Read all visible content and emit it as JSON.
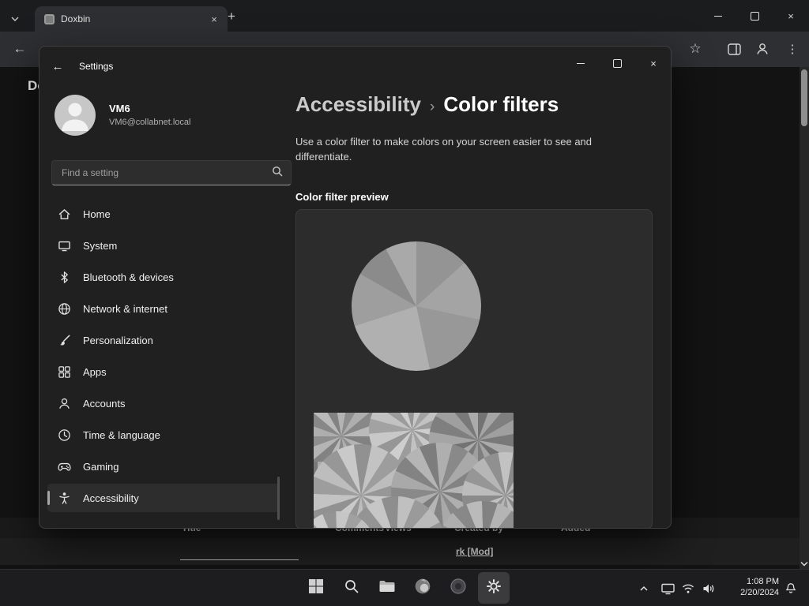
{
  "browser": {
    "tab_title": "Doxbin",
    "page": {
      "heading_fragment": "Do",
      "table": {
        "col_title": "Title",
        "col_comments": "Comments",
        "col_views": "Views",
        "col_created_by": "Created by",
        "col_added": "Added",
        "row_created_by": "rk [Mod]"
      }
    }
  },
  "settings": {
    "window_title": "Settings",
    "user": {
      "name": "VM6",
      "account": "VM6@collabnet.local"
    },
    "search_placeholder": "Find a setting",
    "nav": [
      {
        "label": "Home",
        "icon": "home-icon",
        "selected": false
      },
      {
        "label": "System",
        "icon": "system-icon",
        "selected": false
      },
      {
        "label": "Bluetooth & devices",
        "icon": "bluetooth-icon",
        "selected": false
      },
      {
        "label": "Network & internet",
        "icon": "network-icon",
        "selected": false
      },
      {
        "label": "Personalization",
        "icon": "personalization-icon",
        "selected": false
      },
      {
        "label": "Apps",
        "icon": "apps-icon",
        "selected": false
      },
      {
        "label": "Accounts",
        "icon": "accounts-icon",
        "selected": false
      },
      {
        "label": "Time & language",
        "icon": "time-language-icon",
        "selected": false
      },
      {
        "label": "Gaming",
        "icon": "gaming-icon",
        "selected": false
      },
      {
        "label": "Accessibility",
        "icon": "accessibility-icon",
        "selected": true
      }
    ],
    "breadcrumb": {
      "parent": "Accessibility",
      "separator": "›",
      "current": "Color filters"
    },
    "description": "Use a color filter to make colors on your screen easier to see and differentiate.",
    "preview_label": "Color filter preview",
    "pie_slices": [
      {
        "to": 48,
        "color": "#949494"
      },
      {
        "to": 102,
        "color": "#a4a4a4"
      },
      {
        "to": 168,
        "color": "#989898"
      },
      {
        "to": 252,
        "color": "#b0b0b0"
      },
      {
        "to": 300,
        "color": "#9e9e9e"
      },
      {
        "to": 332,
        "color": "#8b8b8b"
      },
      {
        "to": 360,
        "color": "#a9a9a9"
      }
    ]
  },
  "taskbar": {
    "time": "1:08 PM",
    "date": "2/20/2024"
  }
}
